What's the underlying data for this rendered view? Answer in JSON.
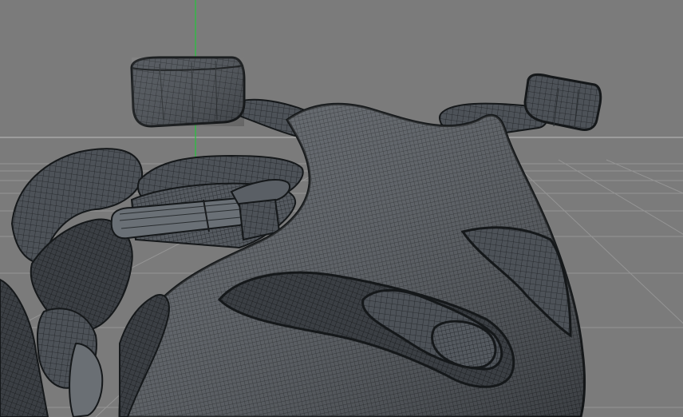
{
  "viewport": {
    "background_color": "#7b7b7b",
    "grid_color": "#9a9a9a",
    "horizon_color": "#bdbdbd",
    "y_axis_color": "#22c63a",
    "mesh_fill": "#4a4f55",
    "mesh_fill_light": "#5c6167",
    "wire_color": "#1c1f22",
    "subject": "motorcycle-front-wireframe"
  }
}
